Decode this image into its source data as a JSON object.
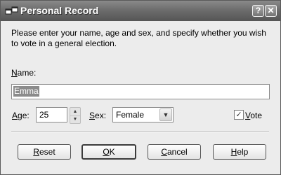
{
  "window": {
    "title": "Personal Record",
    "help_button": "?",
    "close_button": "✕"
  },
  "intro_text": "Please enter your name, age and sex, and specify whether you wish to vote in a general election.",
  "name": {
    "label_access": "N",
    "label_rest": "ame:",
    "value": "Emma"
  },
  "age": {
    "label_access": "A",
    "label_rest": "ge:",
    "value": "25"
  },
  "sex": {
    "label_access": "S",
    "label_rest": "ex:",
    "selected": "Female"
  },
  "vote": {
    "checked": true,
    "check_glyph": "✓",
    "label_access": "V",
    "label_rest": "ote"
  },
  "buttons": {
    "reset": {
      "access": "R",
      "rest": "eset"
    },
    "ok": {
      "access": "O",
      "rest": "K"
    },
    "cancel": {
      "access": "C",
      "rest": "ancel"
    },
    "help": {
      "access": "H",
      "rest": "elp"
    }
  },
  "icons": {
    "app": "app-window-icon",
    "spin_up": "chevron-up-icon",
    "spin_down": "chevron-down-icon",
    "dropdown": "chevron-down-icon"
  },
  "colors": {
    "titlebar": "#6d6d6d",
    "selection": "#8b8b8b",
    "dialog_bg": "#ececec"
  }
}
